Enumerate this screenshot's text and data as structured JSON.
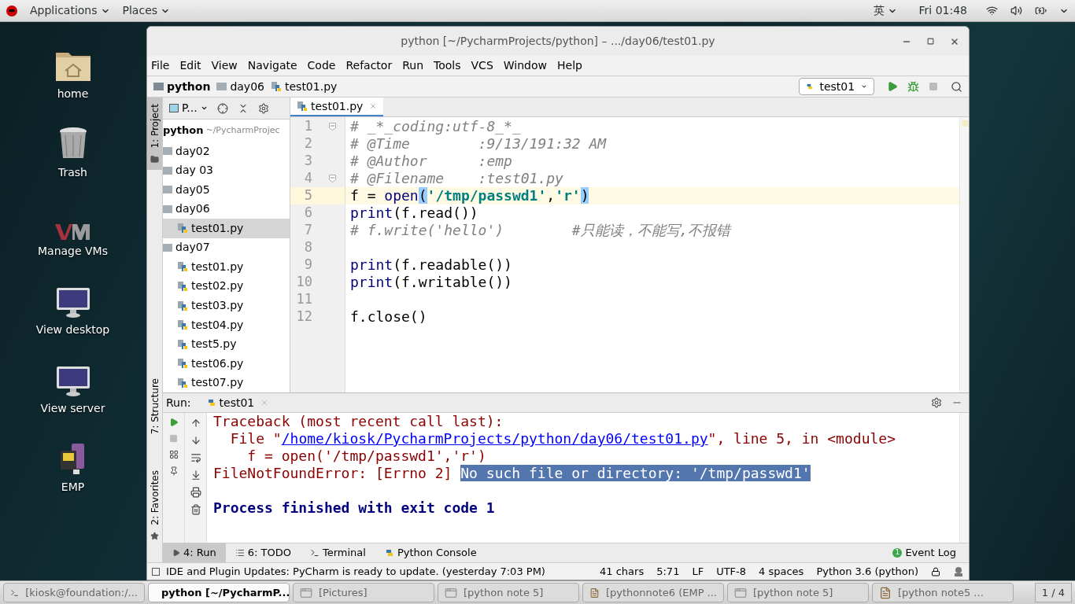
{
  "top_bar": {
    "menus": [
      "Applications",
      "Places"
    ],
    "input_method": "英",
    "clock": "Fri 01:48"
  },
  "desktop_icons": [
    {
      "kind": "home",
      "label": "home"
    },
    {
      "kind": "trash",
      "label": "Trash"
    },
    {
      "kind": "vm",
      "label": "Manage VMs"
    },
    {
      "kind": "monitor",
      "label": "View desktop"
    },
    {
      "kind": "monitor",
      "label": "View server"
    },
    {
      "kind": "emp",
      "label": "EMP"
    }
  ],
  "window": {
    "title": "python [~/PycharmProjects/python] – .../day06/test01.py"
  },
  "menu": [
    "File",
    "Edit",
    "View",
    "Navigate",
    "Code",
    "Refactor",
    "Run",
    "Tools",
    "VCS",
    "Window",
    "Help"
  ],
  "breadcrumb": [
    {
      "kind": "project",
      "label": "python"
    },
    {
      "kind": "folder",
      "label": "day06"
    },
    {
      "kind": "file",
      "label": "test01.py"
    }
  ],
  "run_config": "test01",
  "side_tabs": {
    "top": [
      {
        "label": "1: Project",
        "selected": true
      }
    ],
    "bottom": [
      {
        "label": "7: Structure",
        "selected": false
      },
      {
        "label": "2: Favorites",
        "selected": false
      }
    ]
  },
  "project_panel": {
    "view": "P...",
    "root": {
      "name": "python",
      "path": "~/PycharmProjec"
    },
    "tree": [
      {
        "kind": "folder",
        "label": "day02"
      },
      {
        "kind": "folder",
        "label": "day 03"
      },
      {
        "kind": "folder",
        "label": "day05"
      },
      {
        "kind": "folder",
        "label": "day06",
        "children": [
          {
            "kind": "file",
            "label": "test01.py",
            "selected": true
          }
        ]
      },
      {
        "kind": "folder",
        "label": "day07",
        "children": [
          {
            "kind": "file",
            "label": "test01.py",
            "selected": false
          },
          {
            "kind": "file",
            "label": "test02.py",
            "selected": false
          },
          {
            "kind": "file",
            "label": "test03.py",
            "selected": false
          },
          {
            "kind": "file",
            "label": "test04.py",
            "selected": false
          },
          {
            "kind": "file",
            "label": "test5.py",
            "selected": false
          },
          {
            "kind": "file",
            "label": "test06.py",
            "selected": false
          },
          {
            "kind": "file",
            "label": "test07.py",
            "selected": false
          }
        ]
      }
    ]
  },
  "editor_tabs": [
    {
      "label": "test01.py",
      "selected": true
    }
  ],
  "code_lines": [
    {
      "number": "1",
      "current": false,
      "fold": true,
      "tokens": [
        {
          "kind": "comment",
          "text": "# _*_coding:utf-8_*_"
        }
      ]
    },
    {
      "number": "2",
      "current": false,
      "fold": false,
      "tokens": [
        {
          "kind": "comment",
          "text": "# @Time        :9/13/191:32 AM"
        }
      ]
    },
    {
      "number": "3",
      "current": false,
      "fold": false,
      "tokens": [
        {
          "kind": "comment",
          "text": "# @Author      :emp"
        }
      ]
    },
    {
      "number": "4",
      "current": false,
      "fold": true,
      "tokens": [
        {
          "kind": "comment",
          "text": "# @Filename    :test01.py"
        }
      ]
    },
    {
      "number": "5",
      "current": true,
      "fold": false,
      "tokens": [
        {
          "kind": "plain",
          "text": "f = "
        },
        {
          "kind": "builtin",
          "text": "open"
        },
        {
          "kind": "match",
          "text": "("
        },
        {
          "kind": "string",
          "text": "'/tmp/passwd1'"
        },
        {
          "kind": "plain",
          "text": ","
        },
        {
          "kind": "string",
          "text": "'r'"
        },
        {
          "kind": "match",
          "text": ")"
        }
      ]
    },
    {
      "number": "6",
      "current": false,
      "fold": false,
      "tokens": [
        {
          "kind": "builtin",
          "text": "print"
        },
        {
          "kind": "plain",
          "text": "(f.read())"
        }
      ]
    },
    {
      "number": "7",
      "current": false,
      "fold": false,
      "tokens": [
        {
          "kind": "comment",
          "text": "# f.write('hello')        #只能读，不能写,不报错"
        }
      ]
    },
    {
      "number": "8",
      "current": false,
      "fold": false
    },
    {
      "number": "9",
      "current": false,
      "fold": false,
      "tokens": [
        {
          "kind": "builtin",
          "text": "print"
        },
        {
          "kind": "plain",
          "text": "(f.readable())"
        }
      ]
    },
    {
      "number": "10",
      "current": false,
      "fold": false,
      "tokens": [
        {
          "kind": "builtin",
          "text": "print"
        },
        {
          "kind": "plain",
          "text": "(f.writable())"
        }
      ]
    },
    {
      "number": "11",
      "current": false,
      "fold": false
    },
    {
      "number": "12",
      "current": false,
      "fold": false,
      "tokens": [
        {
          "kind": "plain",
          "text": "f.close()"
        }
      ]
    }
  ],
  "run_panel": {
    "label": "Run:",
    "tab": "test01",
    "output": [
      {
        "kind": "trace",
        "tokens": [
          {
            "kind": "error",
            "text": "Traceback (most recent call last):"
          }
        ]
      },
      {
        "kind": "trace",
        "tokens": [
          {
            "kind": "error",
            "text": "  File \""
          },
          {
            "kind": "link",
            "text": "/home/kiosk/PycharmProjects/python/day06/test01.py"
          },
          {
            "kind": "error",
            "text": "\", line 5, in <module>"
          }
        ]
      },
      {
        "kind": "trace",
        "tokens": [
          {
            "kind": "error",
            "text": "    f = open('/tmp/passwd1','r')"
          }
        ]
      },
      {
        "kind": "trace",
        "tokens": [
          {
            "kind": "error",
            "text": "FileNotFoundError: [Errno 2] "
          },
          {
            "kind": "selected",
            "text": "No such file or directory: '/tmp/passwd1'"
          }
        ]
      },
      {
        "kind": "exit",
        "tokens": [
          {
            "kind": "info",
            "text": "Process finished with exit code 1"
          }
        ]
      }
    ]
  },
  "tool_tabs": [
    {
      "kind": "run",
      "label": "4: Run",
      "selected": true
    },
    {
      "kind": "todo",
      "label": "6: TODO",
      "selected": false
    },
    {
      "kind": "terminal",
      "label": "Terminal",
      "selected": false
    },
    {
      "kind": "console",
      "label": "Python Console",
      "selected": false
    }
  ],
  "event_log": {
    "label": "Event Log",
    "count": "1"
  },
  "status_bar": {
    "message": "IDE and Plugin Updates: PyCharm is ready to update. (yesterday 7:03 PM)",
    "items": [
      "41 chars",
      "5:71",
      "LF",
      "UTF-8",
      "4 spaces",
      "Python 3.6 (python)"
    ]
  },
  "taskbar": {
    "items": [
      {
        "kind": "terminal",
        "label": "[kiosk@foundation:/...",
        "selected": false
      },
      {
        "kind": "pycharm",
        "label": "python [~/PycharmP...",
        "selected": true
      },
      {
        "kind": "window",
        "label": "[Pictures]",
        "selected": false
      },
      {
        "kind": "window",
        "label": "[python note 5]",
        "selected": false
      },
      {
        "kind": "editor",
        "label": "[pythonnote6 (EMP ...",
        "selected": false
      },
      {
        "kind": "window",
        "label": "[python note 5]",
        "selected": false
      },
      {
        "kind": "editor",
        "label": "[python note5 ...",
        "selected": false
      }
    ],
    "workspace": "1 / 4"
  }
}
